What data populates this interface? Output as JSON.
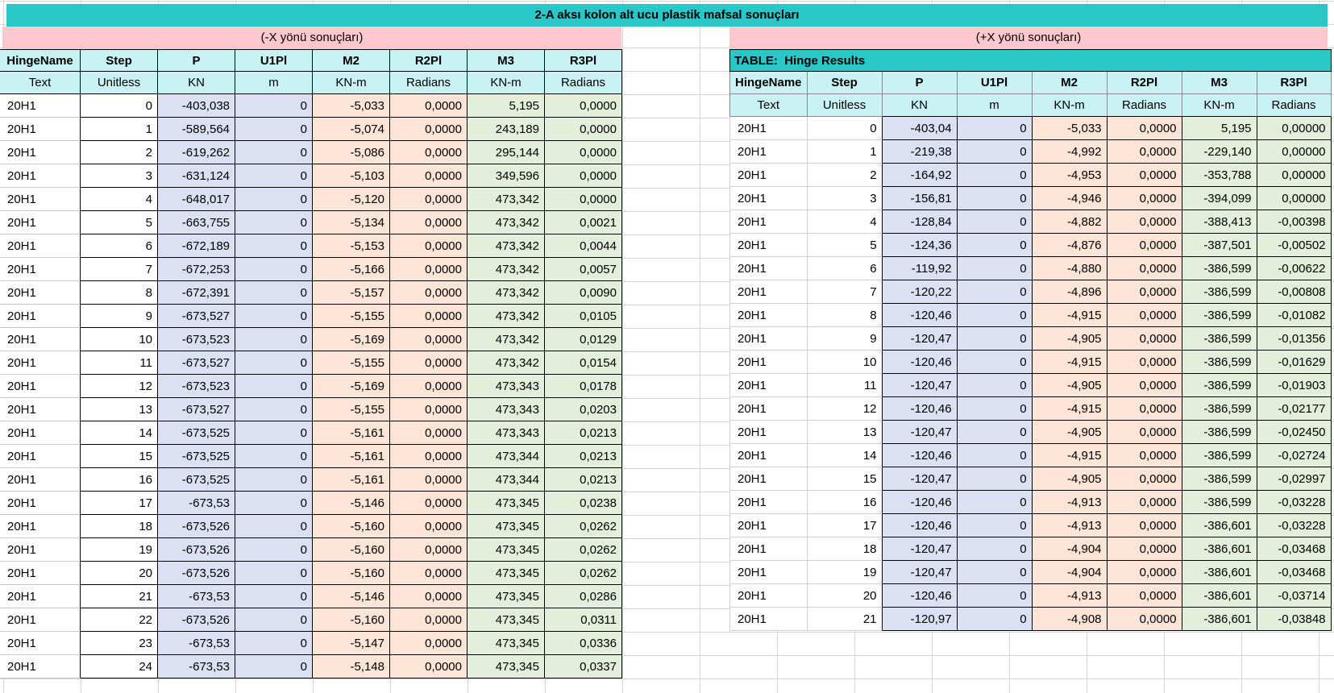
{
  "title": "2-A aksı kolon alt ucu plastik mafsal sonuçları",
  "colors": {
    "teal": "#2AC7C9",
    "pink": "#FFC7CE",
    "header_cyan": "#C9F2F4",
    "lavender": "#D9E1F2",
    "peach": "#FCE4D6",
    "green": "#E2EFDA",
    "grid": "#D6D6D6",
    "border": "#000000"
  },
  "left_table": {
    "caption": "(-X yönü sonuçları)",
    "columns": [
      "HingeName",
      "Step",
      "P",
      "U1Pl",
      "M2",
      "R2Pl",
      "M3",
      "R3Pl"
    ],
    "units": [
      "Text",
      "Unitless",
      "KN",
      "m",
      "KN-m",
      "Radians",
      "KN-m",
      "Radians"
    ],
    "rows": [
      [
        "20H1",
        "0",
        "-403,038",
        "0",
        "-5,033",
        "0,0000",
        "5,195",
        "0,0000"
      ],
      [
        "20H1",
        "1",
        "-589,564",
        "0",
        "-5,074",
        "0,0000",
        "243,189",
        "0,0000"
      ],
      [
        "20H1",
        "2",
        "-619,262",
        "0",
        "-5,086",
        "0,0000",
        "295,144",
        "0,0000"
      ],
      [
        "20H1",
        "3",
        "-631,124",
        "0",
        "-5,103",
        "0,0000",
        "349,596",
        "0,0000"
      ],
      [
        "20H1",
        "4",
        "-648,017",
        "0",
        "-5,120",
        "0,0000",
        "473,342",
        "0,0000"
      ],
      [
        "20H1",
        "5",
        "-663,755",
        "0",
        "-5,134",
        "0,0000",
        "473,342",
        "0,0021"
      ],
      [
        "20H1",
        "6",
        "-672,189",
        "0",
        "-5,153",
        "0,0000",
        "473,342",
        "0,0044"
      ],
      [
        "20H1",
        "7",
        "-672,253",
        "0",
        "-5,166",
        "0,0000",
        "473,342",
        "0,0057"
      ],
      [
        "20H1",
        "8",
        "-672,391",
        "0",
        "-5,157",
        "0,0000",
        "473,342",
        "0,0090"
      ],
      [
        "20H1",
        "9",
        "-673,527",
        "0",
        "-5,155",
        "0,0000",
        "473,342",
        "0,0105"
      ],
      [
        "20H1",
        "10",
        "-673,523",
        "0",
        "-5,169",
        "0,0000",
        "473,342",
        "0,0129"
      ],
      [
        "20H1",
        "11",
        "-673,527",
        "0",
        "-5,155",
        "0,0000",
        "473,342",
        "0,0154"
      ],
      [
        "20H1",
        "12",
        "-673,523",
        "0",
        "-5,169",
        "0,0000",
        "473,343",
        "0,0178"
      ],
      [
        "20H1",
        "13",
        "-673,527",
        "0",
        "-5,155",
        "0,0000",
        "473,343",
        "0,0203"
      ],
      [
        "20H1",
        "14",
        "-673,525",
        "0",
        "-5,161",
        "0,0000",
        "473,343",
        "0,0213"
      ],
      [
        "20H1",
        "15",
        "-673,525",
        "0",
        "-5,161",
        "0,0000",
        "473,344",
        "0,0213"
      ],
      [
        "20H1",
        "16",
        "-673,525",
        "0",
        "-5,161",
        "0,0000",
        "473,344",
        "0,0213"
      ],
      [
        "20H1",
        "17",
        "-673,53",
        "0",
        "-5,146",
        "0,0000",
        "473,345",
        "0,0238"
      ],
      [
        "20H1",
        "18",
        "-673,526",
        "0",
        "-5,160",
        "0,0000",
        "473,345",
        "0,0262"
      ],
      [
        "20H1",
        "19",
        "-673,526",
        "0",
        "-5,160",
        "0,0000",
        "473,345",
        "0,0262"
      ],
      [
        "20H1",
        "20",
        "-673,526",
        "0",
        "-5,160",
        "0,0000",
        "473,345",
        "0,0262"
      ],
      [
        "20H1",
        "21",
        "-673,53",
        "0",
        "-5,146",
        "0,0000",
        "473,345",
        "0,0286"
      ],
      [
        "20H1",
        "22",
        "-673,526",
        "0",
        "-5,160",
        "0,0000",
        "473,345",
        "0,0311"
      ],
      [
        "20H1",
        "23",
        "-673,53",
        "0",
        "-5,147",
        "0,0000",
        "473,345",
        "0,0336"
      ],
      [
        "20H1",
        "24",
        "-673,53",
        "0",
        "-5,148",
        "0,0000",
        "473,345",
        "0,0337"
      ]
    ]
  },
  "right_table": {
    "caption": "(+X yönü sonuçları)",
    "table_label": "TABLE:  Hinge Results",
    "columns": [
      "HingeName",
      "Step",
      "P",
      "U1Pl",
      "M2",
      "R2Pl",
      "M3",
      "R3Pl"
    ],
    "units": [
      "Text",
      "Unitless",
      "KN",
      "m",
      "KN-m",
      "Radians",
      "KN-m",
      "Radians"
    ],
    "rows": [
      [
        "20H1",
        "0",
        "-403,04",
        "0",
        "-5,033",
        "0,0000",
        "5,195",
        "0,00000"
      ],
      [
        "20H1",
        "1",
        "-219,38",
        "0",
        "-4,992",
        "0,0000",
        "-229,140",
        "0,00000"
      ],
      [
        "20H1",
        "2",
        "-164,92",
        "0",
        "-4,953",
        "0,0000",
        "-353,788",
        "0,00000"
      ],
      [
        "20H1",
        "3",
        "-156,81",
        "0",
        "-4,946",
        "0,0000",
        "-394,099",
        "0,00000"
      ],
      [
        "20H1",
        "4",
        "-128,84",
        "0",
        "-4,882",
        "0,0000",
        "-388,413",
        "-0,00398"
      ],
      [
        "20H1",
        "5",
        "-124,36",
        "0",
        "-4,876",
        "0,0000",
        "-387,501",
        "-0,00502"
      ],
      [
        "20H1",
        "6",
        "-119,92",
        "0",
        "-4,880",
        "0,0000",
        "-386,599",
        "-0,00622"
      ],
      [
        "20H1",
        "7",
        "-120,22",
        "0",
        "-4,896",
        "0,0000",
        "-386,599",
        "-0,00808"
      ],
      [
        "20H1",
        "8",
        "-120,46",
        "0",
        "-4,915",
        "0,0000",
        "-386,599",
        "-0,01082"
      ],
      [
        "20H1",
        "9",
        "-120,47",
        "0",
        "-4,905",
        "0,0000",
        "-386,599",
        "-0,01356"
      ],
      [
        "20H1",
        "10",
        "-120,46",
        "0",
        "-4,915",
        "0,0000",
        "-386,599",
        "-0,01629"
      ],
      [
        "20H1",
        "11",
        "-120,47",
        "0",
        "-4,905",
        "0,0000",
        "-386,599",
        "-0,01903"
      ],
      [
        "20H1",
        "12",
        "-120,46",
        "0",
        "-4,915",
        "0,0000",
        "-386,599",
        "-0,02177"
      ],
      [
        "20H1",
        "13",
        "-120,47",
        "0",
        "-4,905",
        "0,0000",
        "-386,599",
        "-0,02450"
      ],
      [
        "20H1",
        "14",
        "-120,46",
        "0",
        "-4,915",
        "0,0000",
        "-386,599",
        "-0,02724"
      ],
      [
        "20H1",
        "15",
        "-120,47",
        "0",
        "-4,905",
        "0,0000",
        "-386,599",
        "-0,02997"
      ],
      [
        "20H1",
        "16",
        "-120,46",
        "0",
        "-4,913",
        "0,0000",
        "-386,599",
        "-0,03228"
      ],
      [
        "20H1",
        "17",
        "-120,46",
        "0",
        "-4,913",
        "0,0000",
        "-386,601",
        "-0,03228"
      ],
      [
        "20H1",
        "18",
        "-120,47",
        "0",
        "-4,904",
        "0,0000",
        "-386,601",
        "-0,03468"
      ],
      [
        "20H1",
        "19",
        "-120,47",
        "0",
        "-4,904",
        "0,0000",
        "-386,601",
        "-0,03468"
      ],
      [
        "20H1",
        "20",
        "-120,46",
        "0",
        "-4,913",
        "0,0000",
        "-386,601",
        "-0,03714"
      ],
      [
        "20H1",
        "21",
        "-120,97",
        "0",
        "-4,908",
        "0,0000",
        "-386,601",
        "-0,03848"
      ]
    ]
  },
  "layout": {
    "left_col_widths": [
      100,
      96,
      96,
      96,
      96,
      96,
      96,
      96
    ],
    "right_col_widths": [
      93,
      93,
      93,
      93,
      93,
      93,
      93,
      92
    ]
  }
}
